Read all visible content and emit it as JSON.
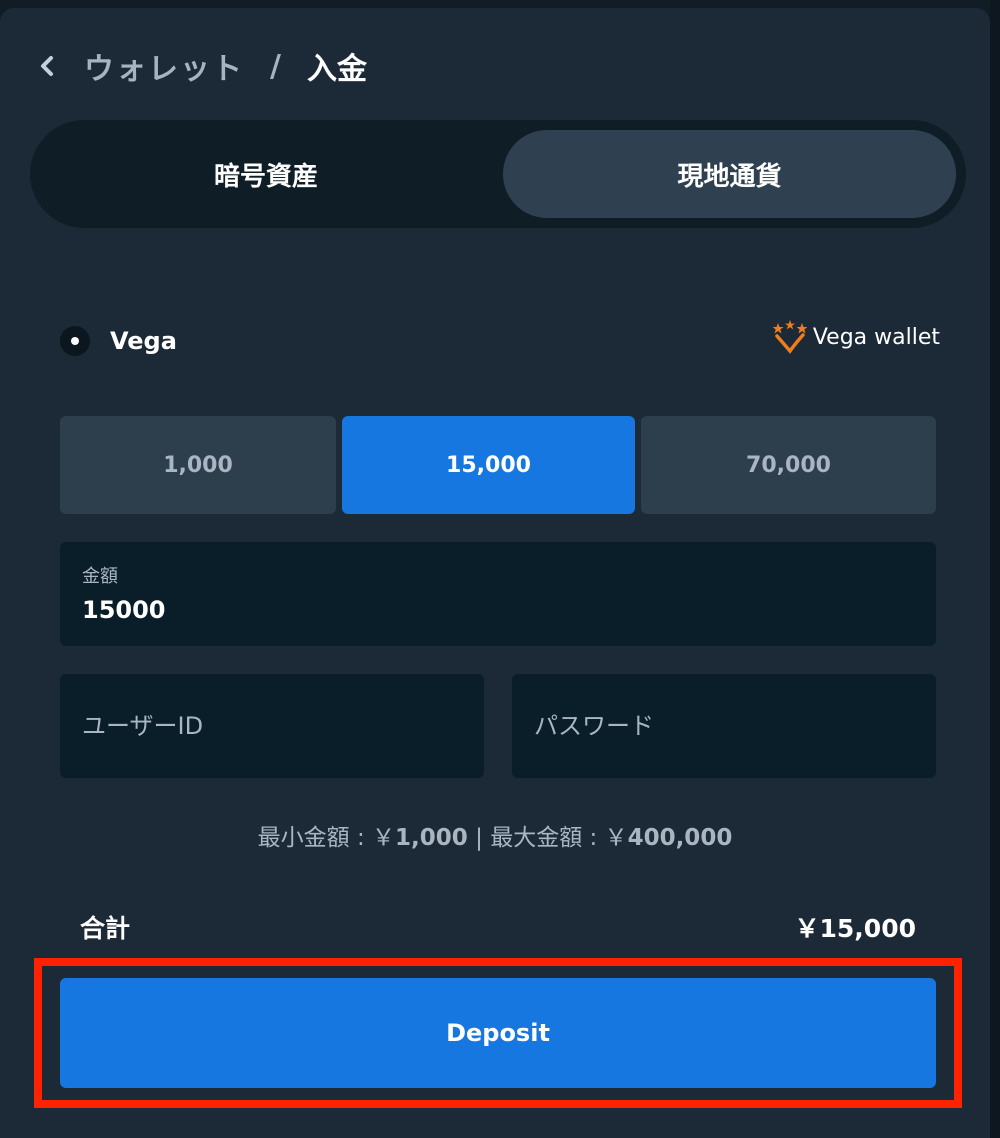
{
  "header": {
    "back_icon": "chevron-left-icon",
    "breadcrumb_prev": "ウォレット",
    "separator": "/",
    "current": "入金"
  },
  "tabs": [
    {
      "label": "暗号資産",
      "active": false
    },
    {
      "label": "現地通貨",
      "active": true
    }
  ],
  "method": {
    "label": "Vega",
    "selected": true,
    "brand_name": "Vega wallet",
    "brand_icon": "vega-logo-icon",
    "brand_color": "#f07d1a"
  },
  "presets": [
    {
      "label": "1,000",
      "selected": false
    },
    {
      "label": "15,000",
      "selected": true
    },
    {
      "label": "70,000",
      "selected": false
    }
  ],
  "amount": {
    "label": "金額",
    "value": "15000"
  },
  "credentials": {
    "user_placeholder": "ユーザーID",
    "password_placeholder": "パスワード"
  },
  "limits": {
    "min_label": "最小金額 : ￥",
    "min_value": "1,000",
    "divider": " | ",
    "max_label": "最大金額 : ￥",
    "max_value": "400,000"
  },
  "total": {
    "label": "合計",
    "value": "￥15,000"
  },
  "deposit": {
    "label": "Deposit"
  },
  "colors": {
    "accent": "#1677e0",
    "highlight": "#ff2200",
    "panel": "#1c2a37"
  }
}
